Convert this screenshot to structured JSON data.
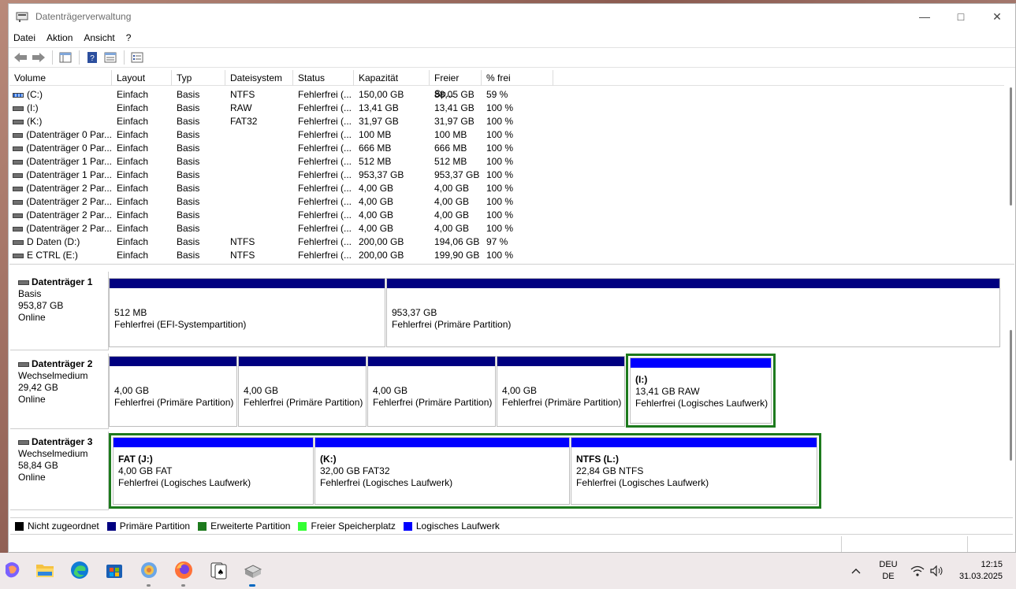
{
  "window": {
    "title": "Datenträgerverwaltung"
  },
  "menu": [
    "Datei",
    "Aktion",
    "Ansicht",
    "?"
  ],
  "columns": [
    "Volume",
    "Layout",
    "Typ",
    "Dateisystem",
    "Status",
    "Kapazität",
    "Freier Sp...",
    "% frei"
  ],
  "volumes": [
    {
      "name": "(C:)",
      "layout": "Einfach",
      "type": "Basis",
      "fs": "NTFS",
      "status": "Fehlerfrei (...",
      "capacity": "150,00 GB",
      "free": "88,05 GB",
      "pct": "59 %",
      "icon": "system-drive-icon"
    },
    {
      "name": "(I:)",
      "layout": "Einfach",
      "type": "Basis",
      "fs": "RAW",
      "status": "Fehlerfrei (...",
      "capacity": "13,41 GB",
      "free": "13,41 GB",
      "pct": "100 %",
      "icon": "drive-icon"
    },
    {
      "name": "(K:)",
      "layout": "Einfach",
      "type": "Basis",
      "fs": "FAT32",
      "status": "Fehlerfrei (...",
      "capacity": "31,97 GB",
      "free": "31,97 GB",
      "pct": "100 %",
      "icon": "drive-icon"
    },
    {
      "name": "(Datenträger 0 Par...",
      "layout": "Einfach",
      "type": "Basis",
      "fs": "",
      "status": "Fehlerfrei (...",
      "capacity": "100 MB",
      "free": "100 MB",
      "pct": "100 %",
      "icon": "drive-icon"
    },
    {
      "name": "(Datenträger 0 Par...",
      "layout": "Einfach",
      "type": "Basis",
      "fs": "",
      "status": "Fehlerfrei (...",
      "capacity": "666 MB",
      "free": "666 MB",
      "pct": "100 %",
      "icon": "drive-icon"
    },
    {
      "name": "(Datenträger 1 Par...",
      "layout": "Einfach",
      "type": "Basis",
      "fs": "",
      "status": "Fehlerfrei (...",
      "capacity": "512 MB",
      "free": "512 MB",
      "pct": "100 %",
      "icon": "drive-icon"
    },
    {
      "name": "(Datenträger 1 Par...",
      "layout": "Einfach",
      "type": "Basis",
      "fs": "",
      "status": "Fehlerfrei (...",
      "capacity": "953,37 GB",
      "free": "953,37 GB",
      "pct": "100 %",
      "icon": "drive-icon"
    },
    {
      "name": "(Datenträger 2 Par...",
      "layout": "Einfach",
      "type": "Basis",
      "fs": "",
      "status": "Fehlerfrei (...",
      "capacity": "4,00 GB",
      "free": "4,00 GB",
      "pct": "100 %",
      "icon": "drive-icon"
    },
    {
      "name": "(Datenträger 2 Par...",
      "layout": "Einfach",
      "type": "Basis",
      "fs": "",
      "status": "Fehlerfrei (...",
      "capacity": "4,00 GB",
      "free": "4,00 GB",
      "pct": "100 %",
      "icon": "drive-icon"
    },
    {
      "name": "(Datenträger 2 Par...",
      "layout": "Einfach",
      "type": "Basis",
      "fs": "",
      "status": "Fehlerfrei (...",
      "capacity": "4,00 GB",
      "free": "4,00 GB",
      "pct": "100 %",
      "icon": "drive-icon"
    },
    {
      "name": "(Datenträger 2 Par...",
      "layout": "Einfach",
      "type": "Basis",
      "fs": "",
      "status": "Fehlerfrei (...",
      "capacity": "4,00 GB",
      "free": "4,00 GB",
      "pct": "100 %",
      "icon": "drive-icon"
    },
    {
      "name": "D Daten (D:)",
      "layout": "Einfach",
      "type": "Basis",
      "fs": "NTFS",
      "status": "Fehlerfrei (...",
      "capacity": "200,00 GB",
      "free": "194,06 GB",
      "pct": "97 %",
      "icon": "drive-icon"
    },
    {
      "name": "E CTRL (E:)",
      "layout": "Einfach",
      "type": "Basis",
      "fs": "NTFS",
      "status": "Fehlerfrei (...",
      "capacity": "200,00 GB",
      "free": "199,90 GB",
      "pct": "100 %",
      "icon": "drive-icon"
    }
  ],
  "disks": [
    {
      "title": "Datenträger 1",
      "kind": "Basis",
      "size": "953,87 GB",
      "state": "Online",
      "parts": [
        {
          "label": "",
          "size": "512 MB",
          "status": "Fehlerfrei (EFI-Systempartition)",
          "type": "primary"
        },
        {
          "label": "",
          "size": "953,37 GB",
          "status": "Fehlerfrei (Primäre Partition)",
          "type": "primary"
        }
      ]
    },
    {
      "title": "Datenträger 2",
      "kind": "Wechselmedium",
      "size": "29,42 GB",
      "state": "Online",
      "parts": [
        {
          "label": "",
          "size": "4,00 GB",
          "status": "Fehlerfrei (Primäre Partition)",
          "type": "primary"
        },
        {
          "label": "",
          "size": "4,00 GB",
          "status": "Fehlerfrei (Primäre Partition)",
          "type": "primary"
        },
        {
          "label": "",
          "size": "4,00 GB",
          "status": "Fehlerfrei (Primäre Partition)",
          "type": "primary"
        },
        {
          "label": "",
          "size": "4,00 GB",
          "status": "Fehlerfrei (Primäre Partition)",
          "type": "primary"
        },
        {
          "label": "(I:)",
          "size": "13,41 GB RAW",
          "status": "Fehlerfrei (Logisches Laufwerk)",
          "type": "logical"
        }
      ]
    },
    {
      "title": "Datenträger 3",
      "kind": "Wechselmedium",
      "size": "58,84 GB",
      "state": "Online",
      "parts": [
        {
          "label": "FAT  (J:)",
          "size": "4,00 GB FAT",
          "status": "Fehlerfrei (Logisches Laufwerk)",
          "type": "logical"
        },
        {
          "label": "(K:)",
          "size": "32,00 GB FAT32",
          "status": "Fehlerfrei (Logisches Laufwerk)",
          "type": "logical"
        },
        {
          "label": "NTFS  (L:)",
          "size": "22,84 GB NTFS",
          "status": "Fehlerfrei (Logisches Laufwerk)",
          "type": "logical"
        }
      ]
    }
  ],
  "legend": [
    {
      "label": "Nicht zugeordnet",
      "color": "#000000"
    },
    {
      "label": "Primäre Partition",
      "color": "#000080"
    },
    {
      "label": "Erweiterte Partition",
      "color": "#1d7a1d"
    },
    {
      "label": "Freier Speicherplatz",
      "color": "#33ff33"
    },
    {
      "label": "Logisches Laufwerk",
      "color": "#0000ff"
    }
  ],
  "taskbar": {
    "apps": [
      "copilot-icon",
      "file-explorer-icon",
      "edge-icon",
      "store-icon",
      "settings-icon",
      "firefox-icon",
      "solitaire-icon",
      "disk-management-icon"
    ],
    "lang_top": "DEU",
    "lang_bottom": "DE",
    "time": "12:15",
    "date": "31.03.2025"
  }
}
